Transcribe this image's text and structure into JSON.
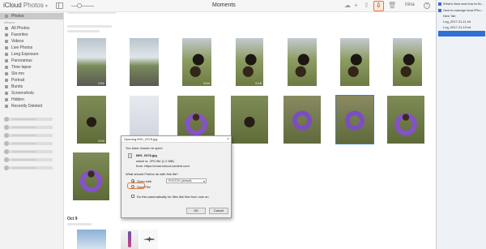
{
  "app": {
    "name": "iCloud",
    "section": "Photos"
  },
  "toolbar": {
    "title": "Moments",
    "user": "Irina",
    "help": "?"
  },
  "sidebar": {
    "items": [
      {
        "label": "Photos",
        "active": true
      },
      {
        "label": "All Photos"
      },
      {
        "label": "Favorites"
      },
      {
        "label": "Videos"
      },
      {
        "label": "Live Photos"
      },
      {
        "label": "Long Exposure"
      },
      {
        "label": "Panoramas"
      },
      {
        "label": "Time-lapse"
      },
      {
        "label": "Slo-mo"
      },
      {
        "label": "Portrait"
      },
      {
        "label": "Bursts"
      },
      {
        "label": "Screenshots"
      },
      {
        "label": "Hidden"
      },
      {
        "label": "Recently Deleted"
      }
    ],
    "albums_header": "Albums"
  },
  "main": {
    "photos_row1_durations": [
      "0:51",
      "",
      "0:04",
      "0:18",
      "",
      "",
      ""
    ],
    "photos_row2_durations": [
      "0:04",
      "",
      "",
      "",
      "",
      "",
      ""
    ],
    "section_label": "Oct 9"
  },
  "right_panel": {
    "items": [
      {
        "label": "What's New and how to fix...",
        "fav": true
      },
      {
        "label": "How to manage local iPho...",
        "fav": true
      },
      {
        "label": "New Tab",
        "fav": false
      },
      {
        "label": "Log_2017-11-11.txt",
        "fav": false
      },
      {
        "label": "Log_2017-11-10.txt",
        "fav": false
      }
    ]
  },
  "dialog": {
    "title": "Opening IMG_0378.jpg",
    "intro": "You have chosen to open:",
    "filename": "IMG_0378.jpg",
    "which_is": "which is: JPG file (1.2 MB)",
    "from": "from: https://cvws.icloud-content.com",
    "question": "What should Firefox do with this file?",
    "open_with_label": "Open with",
    "open_with_value": "PHOTOS (default)",
    "save_file_label": "Save File",
    "auto_label": "Do this automatically for files like this from now on.",
    "ok": "OK",
    "cancel": "Cancel"
  },
  "colors": {
    "accent": "#e4793a",
    "selection": "#2f6fd6"
  }
}
